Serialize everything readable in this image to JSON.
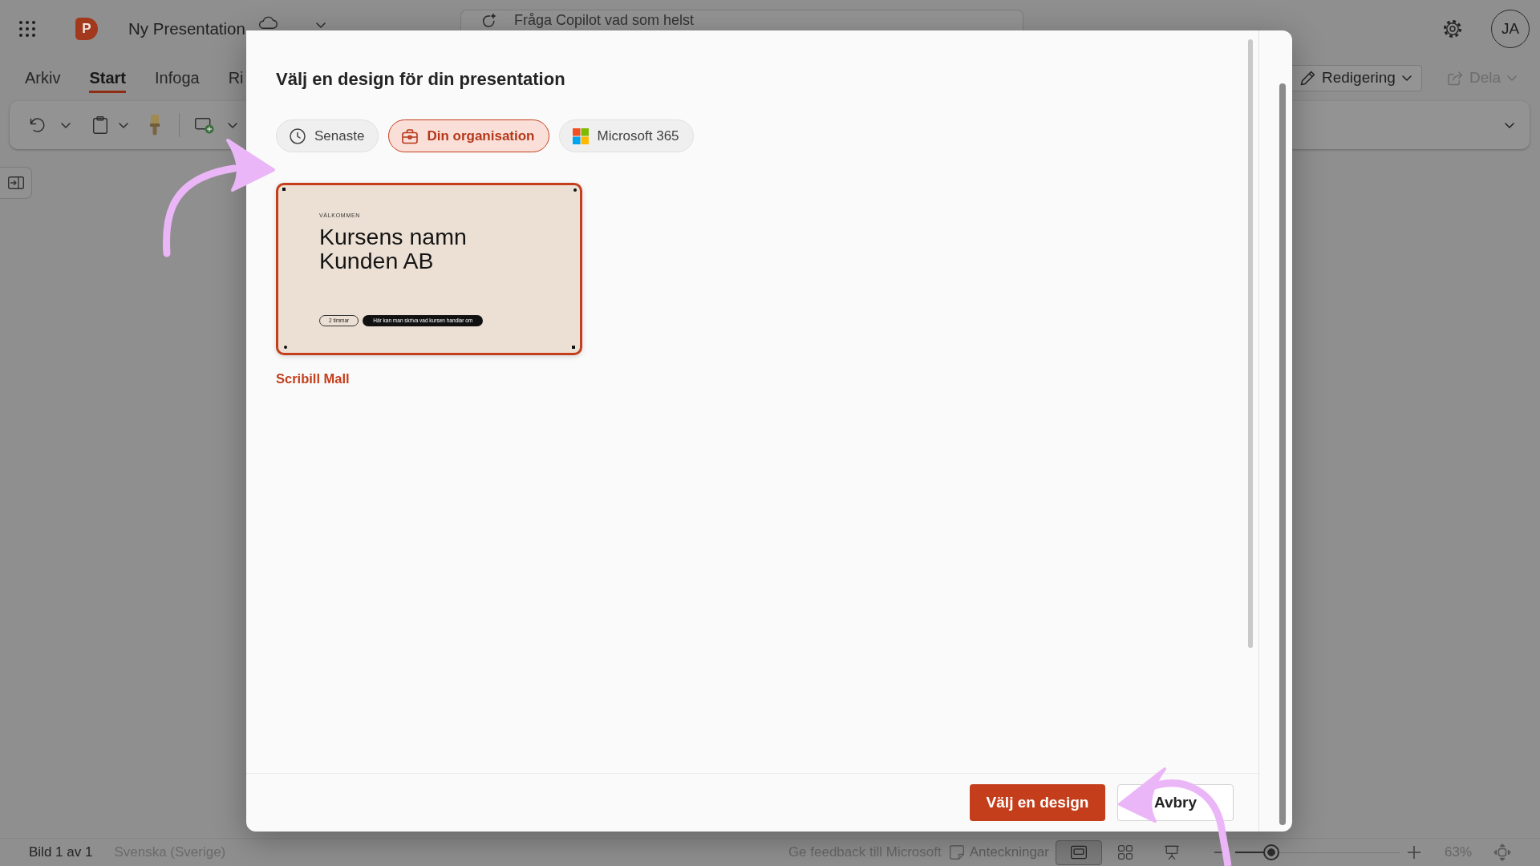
{
  "app_bar": {
    "logo_letter": "P",
    "document_title": "Ny Presentation",
    "search": {
      "placeholder": "Fråga Copilot vad som helst"
    },
    "avatar_initials": "JA"
  },
  "ribbon_tabs": [
    {
      "label": "Arkiv",
      "selected": false
    },
    {
      "label": "Start",
      "selected": true
    },
    {
      "label": "Infoga",
      "selected": false
    },
    {
      "label": "Ri",
      "selected": false
    }
  ],
  "mode_buttons": [
    {
      "label": "Redigering",
      "kind": "edit",
      "disabled": false
    },
    {
      "label": "Dela",
      "kind": "share",
      "disabled": true
    }
  ],
  "dialog": {
    "title": "Välj en design för din presentation",
    "filters": [
      {
        "label": "Senaste",
        "kind": "recent",
        "selected": false
      },
      {
        "label": "Din organisation",
        "kind": "organization",
        "selected": true
      },
      {
        "label": "Microsoft 365",
        "kind": "suite",
        "selected": false
      }
    ],
    "templates": [
      {
        "name": "Scribill Mall",
        "selected": true,
        "slide": {
          "eyebrow": "VÄLKOMMEN",
          "title_lines": [
            "Kursens namn",
            "Kunden AB"
          ],
          "tags": [
            {
              "label": "2 timmar",
              "kind": "outline"
            },
            {
              "label": "Här kan man skriva vad kursen handlar om",
              "kind": "filled"
            }
          ]
        }
      }
    ],
    "buttons": [
      {
        "label": "Välj en design",
        "kind": "primary"
      },
      {
        "label": "Avbry",
        "kind": "secondary"
      }
    ]
  },
  "status_bar": {
    "slide_position": "Bild 1 av 1",
    "language": "Svenska (Sverige)",
    "feedback_link": "Ge feedback till Microsoft",
    "notes_button": "Anteckningar",
    "views": [
      {
        "kind": "normal",
        "selected": true
      },
      {
        "kind": "sorter",
        "selected": false
      },
      {
        "kind": "reading",
        "selected": false
      }
    ],
    "zoom": {
      "level": 0.22,
      "reading": "63%"
    }
  }
}
